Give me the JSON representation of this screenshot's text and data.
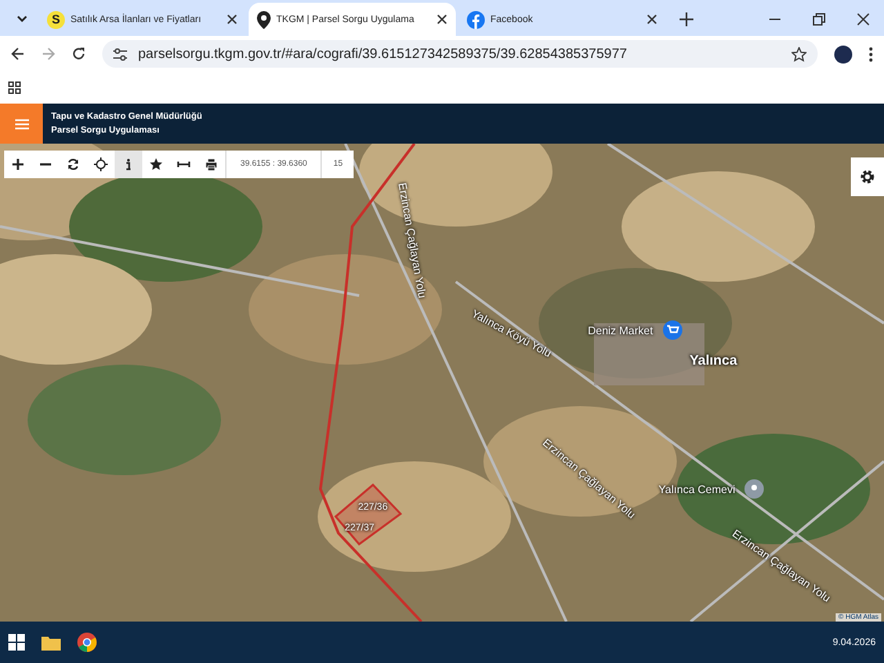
{
  "browser": {
    "tabs": [
      {
        "title": "Satılık Arsa İlanları ve Fiyatları",
        "icon": "S",
        "kind": "letter",
        "selected": false
      },
      {
        "title": "TKGM | Parsel Sorgu Uygulama",
        "kind": "pin",
        "selected": true
      },
      {
        "title": "Facebook",
        "kind": "facebook",
        "selected": false
      }
    ],
    "url": "parselsorgu.tkgm.gov.tr/#ara/cografi/39.615127342589375/39.62854385375977"
  },
  "header": {
    "title": "Tapu ve Kadastro Genel Müdürlüğü",
    "subtitle": "Parsel Sorgu Uygulaması"
  },
  "toolbar": {
    "tools": [
      {
        "kind": "plus",
        "selected": false
      },
      {
        "kind": "minus",
        "selected": false
      },
      {
        "kind": "refresh",
        "selected": false
      },
      {
        "kind": "locate",
        "selected": false
      },
      {
        "kind": "info",
        "selected": true
      },
      {
        "kind": "star",
        "selected": false
      },
      {
        "kind": "measure",
        "selected": false
      },
      {
        "kind": "print",
        "selected": false
      }
    ],
    "coordinates": "39.6155 : 39.6360",
    "zoom": "15"
  },
  "map": {
    "labels": [
      {
        "text": "Erzincan Çağlayan Yolu",
        "kind": "road"
      },
      {
        "text": "Yalınca Köyü Yolu",
        "kind": "road"
      },
      {
        "text": "Deniz Market",
        "kind": "poi-shop"
      },
      {
        "text": "Yalınca",
        "kind": "place"
      },
      {
        "text": "Erzincan Çağlayan Yolu",
        "kind": "road"
      },
      {
        "text": "Yalınca Cemevi",
        "kind": "poi-pin"
      },
      {
        "text": "Erzincan Çağlayan Yolu",
        "kind": "road"
      },
      {
        "text": "227/36",
        "kind": "parcel"
      },
      {
        "text": "227/37",
        "kind": "parcel"
      }
    ],
    "attribution": "© HGM Atlas"
  },
  "taskbar": {
    "date": "9.04.2026"
  }
}
